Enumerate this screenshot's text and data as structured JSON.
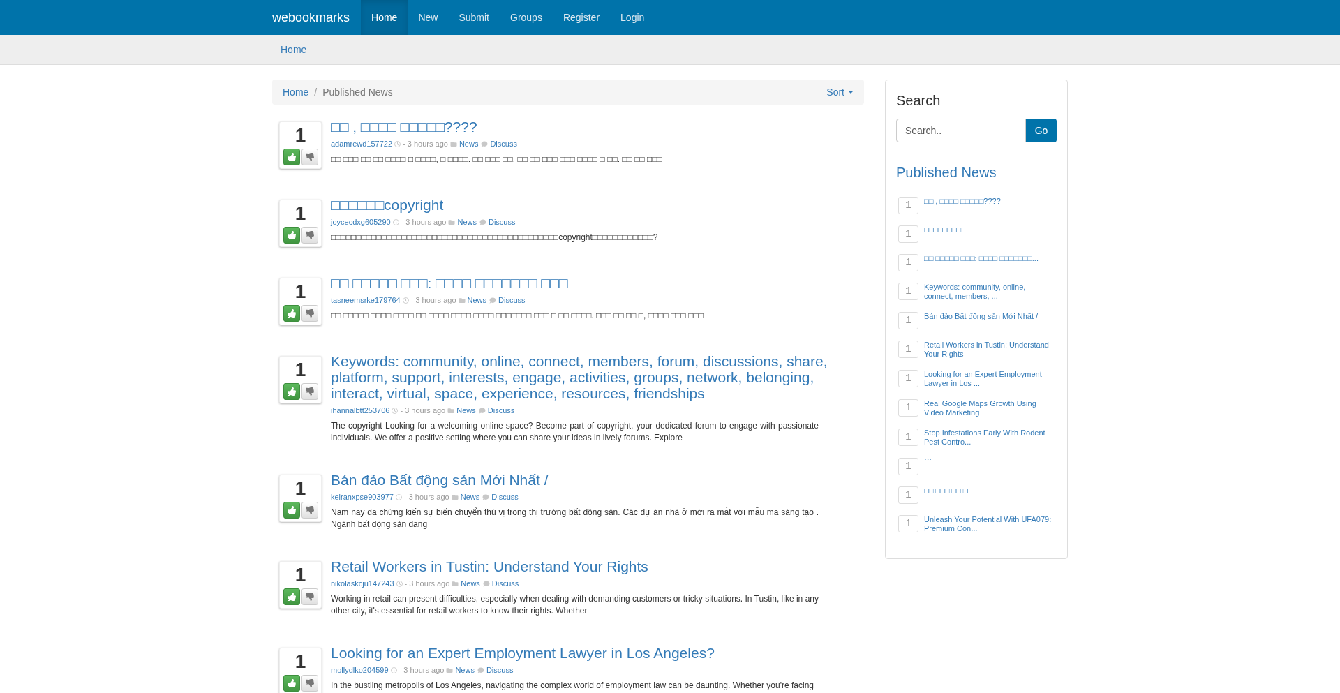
{
  "navbar": {
    "brand": "webookmarks",
    "items": [
      {
        "label": "Home",
        "selected": true
      },
      {
        "label": "New",
        "selected": false
      },
      {
        "label": "Submit",
        "selected": false
      },
      {
        "label": "Groups",
        "selected": false
      },
      {
        "label": "Register",
        "selected": false
      },
      {
        "label": "Login",
        "selected": false
      }
    ]
  },
  "subheader": {
    "link": "Home"
  },
  "breadcrumb": {
    "items": [
      {
        "label": "Home",
        "active": false
      },
      {
        "label": "Published News",
        "active": true
      }
    ],
    "separator": "/",
    "sort": "Sort"
  },
  "posts": [
    {
      "votes": "1",
      "title": "□□ , □□□□ □□□□□????",
      "author": "adamrewd157722",
      "time": "- 3 hours ago",
      "category": "News",
      "discuss": "Discuss",
      "excerpt": "□□ □□□ □□ □□ □□□□ □ □□□□, □ □□□□. □□ □□□ □□. □□ □□ □□□ □□□ □□□□ □ □□. □□ □□ □□□"
    },
    {
      "votes": "1",
      "title": "□□□□□□copyright",
      "author": "joycecdxg605290",
      "time": "- 3 hours ago",
      "category": "News",
      "discuss": "Discuss",
      "excerpt": "□□□□□□□□□□□□□□□□□□□□□□□□□□□□□□□□□□□□□□□□□□□□□copyright□□□□□□□□□□□□?"
    },
    {
      "votes": "1",
      "title": "□□ □□□□□ □□□: □□□□ □□□□□□□ □□□",
      "author": "tasneemsrke179764",
      "time": "- 3 hours ago",
      "category": "News",
      "discuss": "Discuss",
      "excerpt": "□□ □□□□□ □□□□ □□□□ □□ □□□□ □□□□ □□□□ □□□□□□□ □□□ □ □□ □□□□. □□□ □□ □□ □, □□□□ □□□ □□□"
    },
    {
      "votes": "1",
      "title": "Keywords: community, online, connect, members, forum, discussions, share, platform, support, interests, engage, activities, groups, network, belonging, interact, virtual, space, experience, resources, friendships",
      "author": "ihannalbtt253706",
      "time": "- 3 hours ago",
      "category": "News",
      "discuss": "Discuss",
      "excerpt": "The copyright Looking for a welcoming online space? Become part of copyright, your dedicated forum to engage with passionate individuals. We offer a positive setting where you can share your ideas in lively forums. Explore"
    },
    {
      "votes": "1",
      "title": "Bán đảo Bất động sản Mới Nhất /",
      "author": "keiranxpse903977",
      "time": "- 3 hours ago",
      "category": "News",
      "discuss": "Discuss",
      "excerpt": "Năm nay đã chứng kiến sự biến chuyển thú vị trong thị trường bất động sản. Các dự án nhà ở mới ra mắt với mẫu mã sáng tạo . Ngành bất động sản đang"
    },
    {
      "votes": "1",
      "title": "Retail Workers in Tustin: Understand Your Rights",
      "author": "nikolaskcju147243",
      "time": "- 3 hours ago",
      "category": "News",
      "discuss": "Discuss",
      "excerpt": "Working in retail can present difficulties, especially when dealing with demanding customers or tricky situations. In Tustin, like in any other city, it's essential for retail workers to know their rights. Whether"
    },
    {
      "votes": "1",
      "title": "Looking for an Expert Employment Lawyer in Los Angeles?",
      "author": "mollydlko204599",
      "time": "- 3 hours ago",
      "category": "News",
      "discuss": "Discuss",
      "excerpt": "In the bustling metropolis of Los Angeles, navigating the complex world of employment law can be daunting. Whether you're facing"
    }
  ],
  "sidebar": {
    "search": {
      "title": "Search",
      "placeholder": "Search..",
      "button": "Go"
    },
    "published": {
      "title": "Published News",
      "items": [
        {
          "count": "1",
          "title": "□□ , □□□□ □□□□□????"
        },
        {
          "count": "1",
          "title": "□□□□□□□□"
        },
        {
          "count": "1",
          "title": "□□ □□□□□ □□□: □□□□ □□□□□□□..."
        },
        {
          "count": "1",
          "title": "Keywords: community, online, connect, members, ..."
        },
        {
          "count": "1",
          "title": "Bán đảo Bất động sản Mới Nhất /"
        },
        {
          "count": "1",
          "title": "Retail Workers in Tustin: Understand Your Rights"
        },
        {
          "count": "1",
          "title": "Looking for an Expert Employment Lawyer in Los ..."
        },
        {
          "count": "1",
          "title": "Real Google Maps Growth Using Video Marketing"
        },
        {
          "count": "1",
          "title": "Stop Infestations Early With Rodent Pest Contro..."
        },
        {
          "count": "1",
          "title": "```"
        },
        {
          "count": "1",
          "title": "□□ □□□ □□ □□"
        },
        {
          "count": "1",
          "title": "Unleash Your Potential With UFA079: Premium Con..."
        }
      ]
    }
  }
}
